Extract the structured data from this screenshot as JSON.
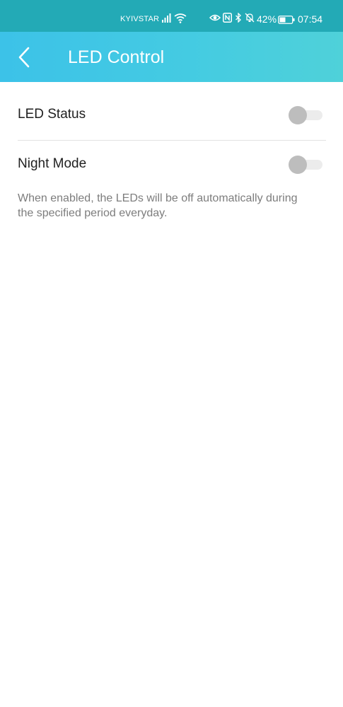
{
  "status_bar": {
    "carrier": "KYIVSTAR",
    "battery_percent": "42%",
    "time": "07:54",
    "icons": [
      "signal-icon",
      "wifi-icon",
      "eye-icon",
      "nfc-icon",
      "bluetooth-icon",
      "mute-bell-icon",
      "battery-icon"
    ]
  },
  "header": {
    "title": "LED Control",
    "back_icon": "chevron-left-icon"
  },
  "settings": {
    "led_status": {
      "label": "LED Status",
      "enabled": false
    },
    "night_mode": {
      "label": "Night Mode",
      "enabled": false,
      "description": "When enabled, the LEDs will be off automatically during the specified period everyday."
    }
  },
  "colors": {
    "header_gradient_start": "#3cc2e8",
    "header_gradient_end": "#4fd1d9",
    "statusbar": "#23aab6",
    "toggle_off_knob": "#bdbdbd",
    "toggle_off_track": "#ececec"
  }
}
